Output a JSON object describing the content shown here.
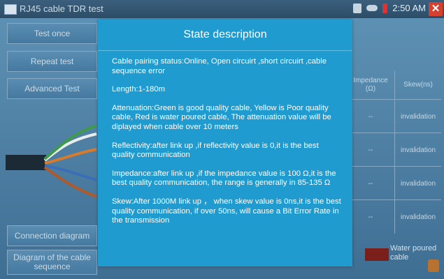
{
  "window": {
    "title": "RJ45 cable TDR test",
    "time": "2:50 AM"
  },
  "left_buttons": {
    "test_once": "Test once",
    "repeat_test": "Repeat test",
    "advanced_test": "Advanced Test",
    "connection_diagram": "Connection diagram",
    "cable_sequence": "Diagram of the cable sequence"
  },
  "table": {
    "headers": [
      "Impedance (Ω)",
      "Skew(ns)"
    ],
    "rows": [
      {
        "impedance": "--",
        "skew": "invalidation"
      },
      {
        "impedance": "--",
        "skew": "invalidation"
      },
      {
        "impedance": "--",
        "skew": "invalidation"
      },
      {
        "impedance": "--",
        "skew": "invalidation"
      }
    ]
  },
  "legend": {
    "label": "Water poured cable",
    "color": "#7a1f1a"
  },
  "modal": {
    "title": "State description",
    "paragraphs": [
      "Cable pairing status:Online, Open circuirt ,short circuirt ,cable sequence error",
      "Length:1-180m",
      "Attenuation:Green is good quality cable, Yellow is Poor quality cable, Red is water poured cable, The attenuation value will be diplayed when cable over 10 meters",
      "Reflectivity:after link up ,if reflectivity value is 0,it is the best quality communication",
      "Impedance:after link up ,if the impedance value is 100 Ω,it is the best quality communication, the range is generally in 85-135 Ω",
      "Skew:After 1000M link up ， when skew value is 0ns,it is the best quality communication, if over 50ns, will cause a Bit Error Rate in the transmission"
    ]
  },
  "colors": {
    "modal_bg": "#1f9bd0",
    "app_bg": "#4f83a8",
    "close": "#d6402e"
  }
}
